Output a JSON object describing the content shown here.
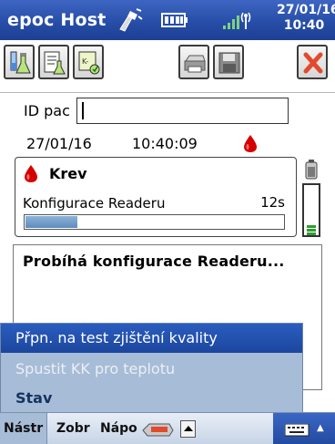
{
  "titlebar": {
    "app_title": "epoc Host",
    "clock_date": "27/01/16",
    "clock_time": "10:40",
    "icons": [
      "connectivity-icon",
      "battery-icon",
      "signal-icon"
    ]
  },
  "toolbar": {
    "buttons": [
      "test-icon",
      "results-icon",
      "device-icon",
      "print-icon",
      "save-icon",
      "close-icon"
    ]
  },
  "patient": {
    "id_label": "ID pac",
    "id_value": "",
    "date": "27/01/16",
    "time": "10:40:09"
  },
  "test_panel": {
    "sample_type": "Krev",
    "status_text": "Konfigurace Readeru",
    "elapsed": "12s",
    "progress_fraction": 0.2
  },
  "message": "Probíhá konfigurace Readeru...",
  "popup_menu": {
    "items": [
      {
        "label": "Přpn. na test zjištění kvality",
        "state": "selected"
      },
      {
        "label": "Spustit KK pro teplotu",
        "state": "disabled"
      },
      {
        "label": "Stav",
        "state": "normal"
      }
    ]
  },
  "menubar": {
    "tabs": [
      "Nástr",
      "Zobr",
      "Nápo"
    ],
    "icons": [
      "card-icon",
      "up-arrow-icon",
      "keyboard-icon"
    ]
  },
  "colors": {
    "title_blue": "#274ea8",
    "menu_highlight": "#1f4ca8",
    "menu_bg": "#a7bcd7",
    "blood_red": "#d40000",
    "progress_blue": "#6f97c6"
  }
}
